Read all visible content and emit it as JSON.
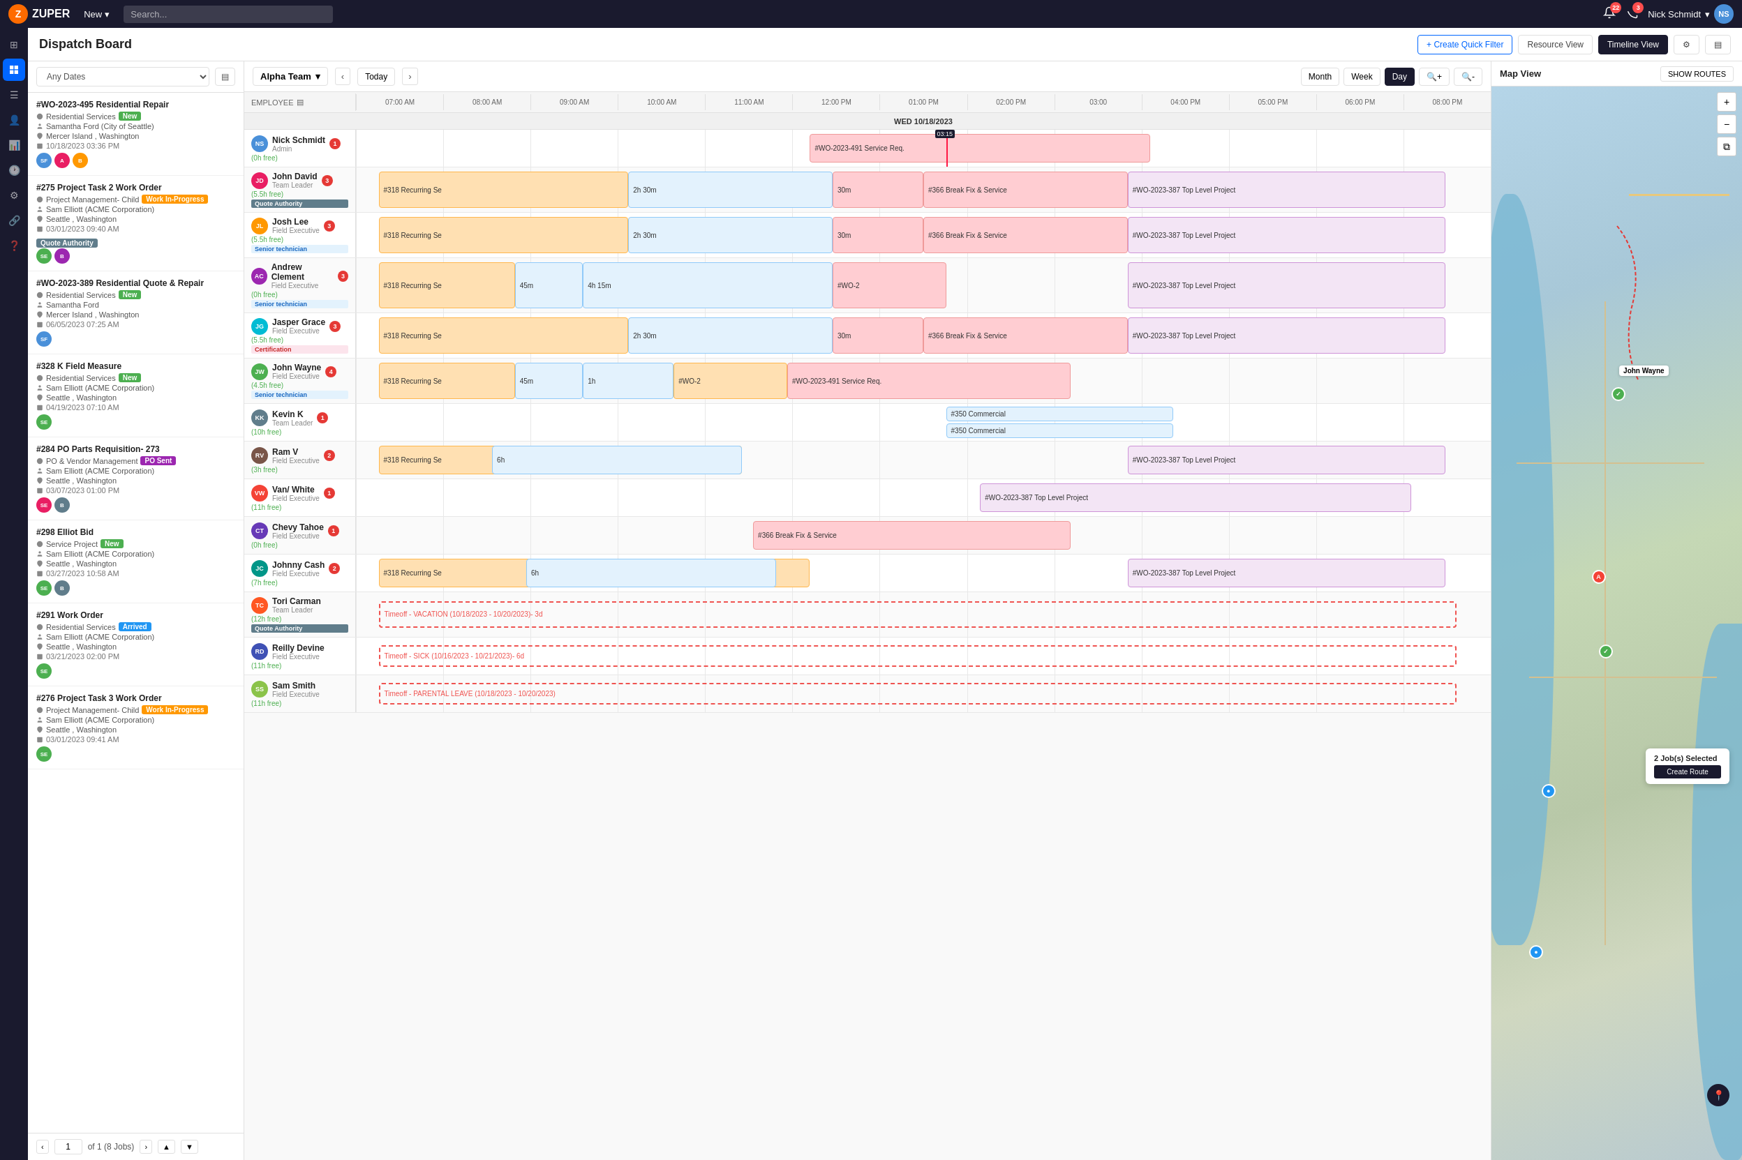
{
  "navbar": {
    "logo_text": "ZUPER",
    "new_label": "New",
    "search_placeholder": "Search...",
    "notifications_count": "22",
    "alerts_count": "3",
    "user_name": "Nick Schmidt",
    "user_initials": "NS"
  },
  "dispatch": {
    "title": "Dispatch Board",
    "create_quick_filter": "+ Create Quick Filter",
    "resource_view": "Resource View",
    "timeline_view": "Timeline View",
    "filter_label": "Any Dates",
    "team_name": "Alpha Team",
    "date_label": "WED 10/18/2023",
    "today_btn": "Today",
    "month_btn": "Month",
    "week_btn": "Week",
    "day_btn": "Day",
    "map_view": "Map View",
    "show_routes": "SHOW ROUTES"
  },
  "time_slots": [
    "07:00 AM",
    "08:00 AM",
    "09:00 AM",
    "10:00 AM",
    "11:00 AM",
    "12:00 PM",
    "01:00 PM",
    "02:00 PM",
    "03:00",
    "04:00 PM",
    "05:00 PM",
    "06:00 PM",
    "08:00 PM"
  ],
  "employees": [
    {
      "name": "Nick Schmidt",
      "role": "Admin",
      "time_free": "(0h free)",
      "notif": 1,
      "avatar_color": "#4a90d9",
      "initials": "NS",
      "bars": [
        {
          "label": "#WO-2023-491 Service Req.",
          "color": "bar-red",
          "left": "40%",
          "width": "30%"
        }
      ]
    },
    {
      "name": "John David",
      "role": "Team Leader",
      "time_free": "(5.5h free)",
      "badge": "Quote Authority",
      "badge_class": "qa",
      "notif": 3,
      "avatar_color": "#e91e63",
      "initials": "JD",
      "bars": [
        {
          "label": "#318 Recurring Se",
          "color": "bar-orange",
          "left": "2%",
          "width": "22%"
        },
        {
          "label": "2h 30m",
          "color": "bar-blue",
          "left": "24%",
          "width": "18%"
        },
        {
          "label": "30m",
          "color": "bar-red",
          "left": "42%",
          "width": "8%"
        },
        {
          "label": "#366 Break Fix & Service",
          "color": "bar-red",
          "left": "50%",
          "width": "18%"
        },
        {
          "label": "#WO-2023-387 Top Level Project",
          "color": "bar-purple",
          "left": "68%",
          "width": "28%"
        }
      ]
    },
    {
      "name": "Josh Lee",
      "role": "Field Executive",
      "time_free": "(5.5h free)",
      "badge": "Senior technician",
      "badge_class": "senior",
      "notif": 3,
      "avatar_color": "#ff9800",
      "initials": "JL",
      "bars": [
        {
          "label": "#318 Recurring Se",
          "color": "bar-orange",
          "left": "2%",
          "width": "22%"
        },
        {
          "label": "2h 30m",
          "color": "bar-blue",
          "left": "24%",
          "width": "18%"
        },
        {
          "label": "30m",
          "color": "bar-red",
          "left": "42%",
          "width": "8%"
        },
        {
          "label": "#366 Break Fix & Service",
          "color": "bar-red",
          "left": "50%",
          "width": "18%"
        },
        {
          "label": "#WO-2023-387 Top Level Project",
          "color": "bar-purple",
          "left": "68%",
          "width": "28%"
        }
      ]
    },
    {
      "name": "Andrew Clement",
      "role": "Field Executive",
      "time_free": "(0h free)",
      "badge": "Senior technician",
      "badge_class": "senior",
      "notif": 3,
      "avatar_color": "#9c27b0",
      "initials": "AC",
      "bars": [
        {
          "label": "#318 Recurring Se",
          "color": "bar-orange",
          "left": "2%",
          "width": "12%"
        },
        {
          "label": "45m",
          "color": "bar-blue",
          "left": "14%",
          "width": "6%"
        },
        {
          "label": "4h 15m",
          "color": "bar-blue",
          "left": "20%",
          "width": "22%"
        },
        {
          "label": "#WO-2",
          "color": "bar-red",
          "left": "42%",
          "width": "10%"
        },
        {
          "label": "#WO-2023-387 Top Level Project",
          "color": "bar-purple",
          "left": "68%",
          "width": "28%"
        }
      ]
    },
    {
      "name": "Jasper Grace",
      "role": "Field Executive",
      "time_free": "(5.5h free)",
      "badge": "Certification",
      "badge_class": "cert",
      "notif": 3,
      "avatar_color": "#00bcd4",
      "initials": "JG",
      "bars": [
        {
          "label": "#318 Recurring Se",
          "color": "bar-orange",
          "left": "2%",
          "width": "22%"
        },
        {
          "label": "2h 30m",
          "color": "bar-blue",
          "left": "24%",
          "width": "18%"
        },
        {
          "label": "30m",
          "color": "bar-red",
          "left": "42%",
          "width": "8%"
        },
        {
          "label": "#366 Break Fix & Service",
          "color": "bar-red",
          "left": "50%",
          "width": "18%"
        },
        {
          "label": "#WO-2023-387 Top Level Project",
          "color": "bar-purple",
          "left": "68%",
          "width": "28%"
        }
      ]
    },
    {
      "name": "John Wayne",
      "role": "Field Executive",
      "time_free": "(4.5h free)",
      "badge": "Senior technician",
      "badge_class": "senior",
      "notif": 4,
      "avatar_color": "#4caf50",
      "initials": "JW",
      "bars": [
        {
          "label": "#318 Recurring Se",
          "color": "bar-orange",
          "left": "2%",
          "width": "12%"
        },
        {
          "label": "45m",
          "color": "bar-blue",
          "left": "14%",
          "width": "6%"
        },
        {
          "label": "1h",
          "color": "bar-blue",
          "left": "20%",
          "width": "8%"
        },
        {
          "label": "#WO-2",
          "color": "bar-orange",
          "left": "28%",
          "width": "10%"
        },
        {
          "label": "#WO-2023-491 Service Req.",
          "color": "bar-red",
          "left": "38%",
          "width": "25%"
        }
      ]
    },
    {
      "name": "Kevin K",
      "role": "Team Leader",
      "time_free": "(10h free)",
      "notif": 1,
      "avatar_color": "#607d8b",
      "initials": "KK",
      "bars": [
        {
          "label": "#350 Commercial",
          "color": "bar-blue",
          "left": "52%",
          "width": "20%"
        },
        {
          "label": "#350 Commercial",
          "color": "bar-blue",
          "left": "52%",
          "width": "20%",
          "top": "52%"
        }
      ]
    },
    {
      "name": "Ram V",
      "role": "Field Executive",
      "time_free": "(3h free)",
      "notif": 2,
      "avatar_color": "#795548",
      "initials": "RV",
      "bars": [
        {
          "label": "#318 Recurring Se",
          "color": "bar-orange",
          "left": "2%",
          "width": "32%"
        },
        {
          "label": "6h",
          "color": "bar-blue",
          "left": "12%",
          "width": "22%"
        },
        {
          "label": "#WO-2023-387 Top Level Project",
          "color": "bar-purple",
          "left": "68%",
          "width": "28%"
        }
      ]
    },
    {
      "name": "Van/ White",
      "role": "Field Executive",
      "time_free": "(11h free)",
      "notif": 1,
      "avatar_color": "#f44336",
      "initials": "VW",
      "bars": [
        {
          "label": "#WO-2023-387 Top Level Project",
          "color": "bar-purple",
          "left": "55%",
          "width": "38%"
        }
      ]
    },
    {
      "name": "Chevy Tahoe",
      "role": "Field Executive",
      "time_free": "(0h free)",
      "notif": 1,
      "avatar_color": "#673ab7",
      "initials": "CT",
      "bars": [
        {
          "label": "#366 Break Fix & Service",
          "color": "bar-red",
          "left": "35%",
          "width": "28%"
        }
      ]
    },
    {
      "name": "Johnny Cash",
      "role": "Field Executive",
      "time_free": "(7h free)",
      "notif": 2,
      "avatar_color": "#009688",
      "initials": "JC",
      "bars": [
        {
          "label": "#318 Recurring Se",
          "color": "bar-orange",
          "left": "2%",
          "width": "38%"
        },
        {
          "label": "6h",
          "color": "bar-blue",
          "left": "15%",
          "width": "22%"
        },
        {
          "label": "#WO-2023-387 Top Level Project",
          "color": "bar-purple",
          "left": "68%",
          "width": "28%"
        }
      ]
    },
    {
      "name": "Tori Carman",
      "role": "Team Leader",
      "time_free": "(12h free)",
      "badge": "Quote Authority",
      "badge_class": "qa",
      "notif": 0,
      "avatar_color": "#ff5722",
      "initials": "TC",
      "bars": [
        {
          "label": "Timeoff - VACATION (10/18/2023 - 10/20/2023)- 3d",
          "color": "bar-dashed",
          "left": "2%",
          "width": "95%"
        }
      ]
    },
    {
      "name": "Reilly Devine",
      "role": "Field Executive",
      "time_free": "(11h free)",
      "notif": 0,
      "avatar_color": "#3f51b5",
      "initials": "RD",
      "bars": [
        {
          "label": "Timeoff - SICK (10/16/2023 - 10/21/2023)- 6d",
          "color": "bar-dashed",
          "left": "2%",
          "width": "95%"
        }
      ]
    },
    {
      "name": "Sam Smith",
      "role": "Field Executive",
      "time_free": "(11h free)",
      "notif": 0,
      "avatar_color": "#8bc34a",
      "initials": "SS",
      "bars": [
        {
          "label": "Timeoff - PARENTAL LEAVE (10/18/2023 - 10/20/2023)",
          "color": "bar-dashed",
          "left": "2%",
          "width": "95%"
        }
      ]
    }
  ],
  "jobs": [
    {
      "id": "#WO-2023-495 Residential Repair",
      "service": "Residential Services",
      "service_tag": "New",
      "service_tag_class": "tag-new",
      "client": "Samantha Ford (City of Seattle)",
      "location": "Mercer Island , Washington",
      "date": "10/18/2023 03:36 PM",
      "avatars": [
        {
          "color": "#4a90d9",
          "initials": "SF"
        },
        {
          "color": "#e91e63",
          "initials": "A"
        },
        {
          "color": "#ff9800",
          "initials": "B"
        }
      ]
    },
    {
      "id": "#275 Project Task 2 Work Order",
      "service": "Project Management- Child",
      "service_tag": "Work In-Progress",
      "service_tag_class": "tag-wip",
      "client": "Sam Elliott (ACME Corporation)",
      "extra_badge": "Quote Authority",
      "location": "Seattle , Washington",
      "date": "03/01/2023 09:40 AM",
      "avatars": [
        {
          "color": "#4caf50",
          "initials": "SE"
        },
        {
          "color": "#9c27b0",
          "initials": "B"
        }
      ]
    },
    {
      "id": "#WO-2023-389 Residential Quote & Repair",
      "service": "Residential Services",
      "service_tag": "New",
      "service_tag_class": "tag-new",
      "client": "Samantha Ford",
      "location": "Mercer Island , Washington",
      "date": "06/05/2023 07:25 AM",
      "avatars": [
        {
          "color": "#4a90d9",
          "initials": "SF"
        }
      ]
    },
    {
      "id": "#328 K Field Measure",
      "service": "Residential Services",
      "service_tag": "New",
      "service_tag_class": "tag-new",
      "client": "Sam Elliott (ACME Corporation)",
      "location": "Seattle , Washington",
      "date": "04/19/2023 07:10 AM",
      "avatars": [
        {
          "color": "#4caf50",
          "initials": "SE"
        }
      ]
    },
    {
      "id": "#284 PO Parts Requisition- 273",
      "service": "PO & Vendor Management",
      "service_tag": "PO Sent",
      "service_tag_class": "tag-po-sent",
      "client": "Sam Elliott (ACME Corporation)",
      "location": "Seattle , Washington",
      "date": "03/07/2023 01:00 PM",
      "avatars": [
        {
          "color": "#e91e63",
          "initials": "SE"
        },
        {
          "color": "#607d8b",
          "initials": "B"
        }
      ]
    },
    {
      "id": "#298 Elliot Bid",
      "service": "Service Project",
      "service_tag": "New",
      "service_tag_class": "tag-new",
      "client": "Sam Elliott (ACME Corporation)",
      "location": "Seattle , Washington",
      "date": "03/27/2023 10:58 AM",
      "avatars": [
        {
          "color": "#4caf50",
          "initials": "SE"
        },
        {
          "color": "#607d8b",
          "initials": "B"
        }
      ]
    },
    {
      "id": "#291 Work Order",
      "service": "Residential Services",
      "service_tag": "Arrived",
      "service_tag_class": "tag-arrived",
      "client": "Sam Elliott (ACME Corporation)",
      "location": "Seattle , Washington",
      "date": "03/21/2023 02:00 PM",
      "avatars": [
        {
          "color": "#4caf50",
          "initials": "SE"
        }
      ]
    },
    {
      "id": "#276 Project Task 3 Work Order",
      "service": "Project Management- Child",
      "service_tag": "Work In-Progress",
      "service_tag_class": "tag-wip",
      "client": "Sam Elliott (ACME Corporation)",
      "location": "Seattle , Washington",
      "date": "03/01/2023 09:41 AM",
      "avatars": [
        {
          "color": "#4caf50",
          "initials": "SE"
        }
      ]
    }
  ],
  "pagination": {
    "page": "1",
    "of_text": "of 1 (8 Jobs)"
  },
  "map": {
    "title": "Map View",
    "show_routes": "SHOW ROUTES",
    "popup": {
      "title": "2 Job(s) Selected",
      "btn_label": "Create Route"
    }
  },
  "sidebar_icons": [
    {
      "icon": "⊞",
      "name": "grid"
    },
    {
      "icon": "◎",
      "name": "dispatch"
    },
    {
      "icon": "☰",
      "name": "list"
    },
    {
      "icon": "👤",
      "name": "contacts"
    },
    {
      "icon": "📊",
      "name": "reports"
    },
    {
      "icon": "🕐",
      "name": "time"
    },
    {
      "icon": "⚙",
      "name": "settings"
    },
    {
      "icon": "☁",
      "name": "cloud"
    }
  ]
}
